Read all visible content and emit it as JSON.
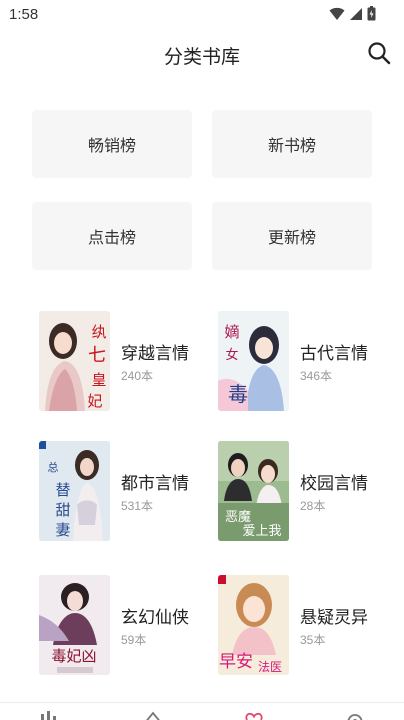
{
  "status": {
    "time": "1:58"
  },
  "header": {
    "title": "分类书库"
  },
  "rankings": [
    {
      "label": "畅销榜"
    },
    {
      "label": "新书榜"
    },
    {
      "label": "点击榜"
    },
    {
      "label": "更新榜"
    }
  ],
  "categories": [
    {
      "name": "穿越言情",
      "count": "240本"
    },
    {
      "name": "古代言情",
      "count": "346本"
    },
    {
      "name": "都市言情",
      "count": "531本"
    },
    {
      "name": "校园言情",
      "count": "28本"
    },
    {
      "name": "玄幻仙侠",
      "count": "59本"
    },
    {
      "name": "悬疑灵异",
      "count": "35本"
    }
  ],
  "covers": [
    {
      "title_art": "纨绔七皇妃",
      "bg": "#f3ece6"
    },
    {
      "title_art": "嫡女毒妾",
      "bg": "#eaf0f4"
    },
    {
      "title_art": "替身甜妻",
      "bg": "#dfe9ef"
    },
    {
      "title_art": "恶魔小爷爱上我",
      "bg": "#8fae85"
    },
    {
      "title_art": "毒妃太凶猛",
      "bg": "#efe8ec"
    },
    {
      "title_art": "早安法医先生",
      "bg": "#f4ead9"
    }
  ],
  "colors": {
    "accent": "#e8456b",
    "card_bg": "#f6f6f6",
    "muted": "#999999"
  }
}
